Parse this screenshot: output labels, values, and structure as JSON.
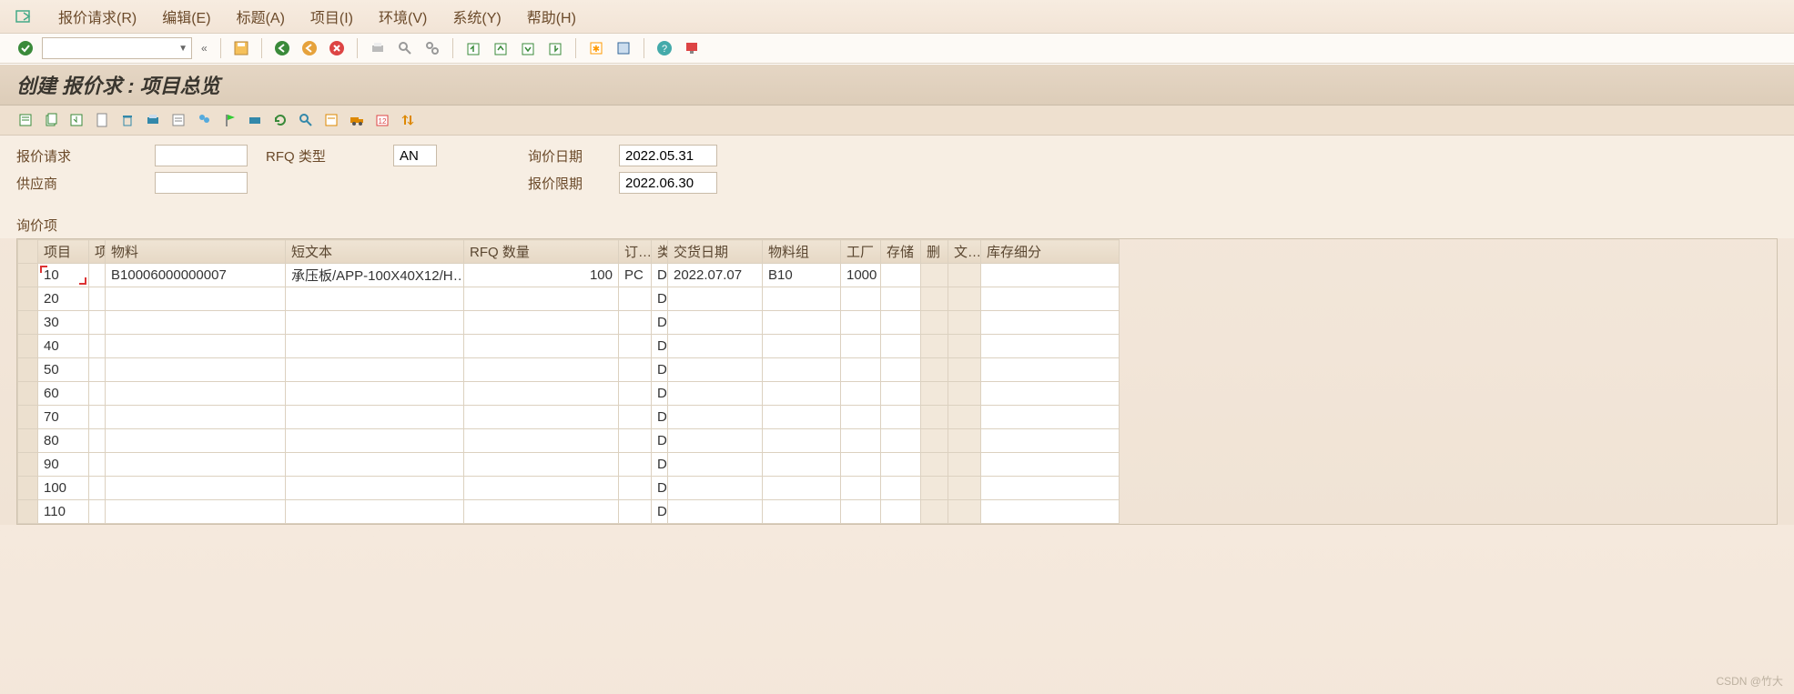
{
  "menu": {
    "items": [
      "报价请求(R)",
      "编辑(E)",
      "标题(A)",
      "项目(I)",
      "环境(V)",
      "系统(Y)",
      "帮助(H)"
    ]
  },
  "title": "创建 报价求 : 项目总览",
  "header": {
    "rfq_request_label": "报价请求",
    "rfq_request_value": "",
    "rfq_type_label": "RFQ 类型",
    "rfq_type_value": "AN",
    "inquiry_date_label": "询价日期",
    "inquiry_date_value": "2022.05.31",
    "vendor_label": "供应商",
    "vendor_value": "",
    "quote_deadline_label": "报价限期",
    "quote_deadline_value": "2022.06.30"
  },
  "section_label": "询价项",
  "columns": {
    "rowsel": "",
    "item": "项目",
    "i_col": "项",
    "material": "物料",
    "short_text": "短文本",
    "rfq_qty": "RFQ 数量",
    "order": "订…",
    "cat": "类",
    "delivery_date": "交货日期",
    "matl_group": "物料组",
    "plant": "工厂",
    "stor": "存储",
    "del": "删",
    "text": "文…",
    "stock_detail": "库存细分"
  },
  "rows": [
    {
      "item": "10",
      "material": "B10006000000007",
      "short_text": "承压板/APP-100X40X12/H…",
      "rfq_qty": "100",
      "order": "PC",
      "cat": "D",
      "delivery_date": "2022.07.07",
      "matl_group": "B10",
      "plant": "1000"
    },
    {
      "item": "20",
      "cat": "D"
    },
    {
      "item": "30",
      "cat": "D"
    },
    {
      "item": "40",
      "cat": "D"
    },
    {
      "item": "50",
      "cat": "D"
    },
    {
      "item": "60",
      "cat": "D"
    },
    {
      "item": "70",
      "cat": "D"
    },
    {
      "item": "80",
      "cat": "D"
    },
    {
      "item": "90",
      "cat": "D"
    },
    {
      "item": "100",
      "cat": "D"
    },
    {
      "item": "110",
      "cat": "D"
    }
  ],
  "watermark": "CSDN @竹大"
}
